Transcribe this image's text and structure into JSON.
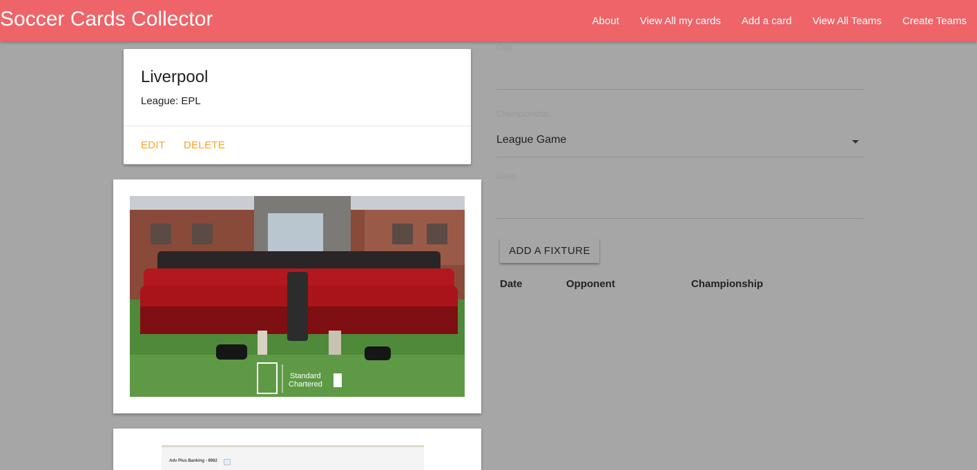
{
  "app": {
    "title": "Soccer Cards Collector"
  },
  "nav": {
    "items": [
      "About",
      "View All my cards",
      "Add a card",
      "View All Teams",
      "Create Teams"
    ]
  },
  "team": {
    "name": "Liverpool",
    "league_label": "League: EPL",
    "edit_label": "EDIT",
    "delete_label": "DELETE"
  },
  "team_photo": {
    "sponsor_line1": "Standard",
    "sponsor_line2": "Chartered"
  },
  "secondary_card": {
    "text": "Adv Plus Banking - 8982"
  },
  "form": {
    "opp_label": "Opp:",
    "opp_value": "",
    "championship_label": "Championship:",
    "championship_value": "League Game",
    "date_label": "Date:",
    "date_value": "",
    "submit_label": "ADD A FIXTURE"
  },
  "fixtures_table": {
    "headers": [
      "Date",
      "Opponent",
      "Championship"
    ],
    "rows": []
  },
  "colors": {
    "navbar": "#ee6468",
    "accent": "#f5a623",
    "background": "#a6a6a6"
  }
}
